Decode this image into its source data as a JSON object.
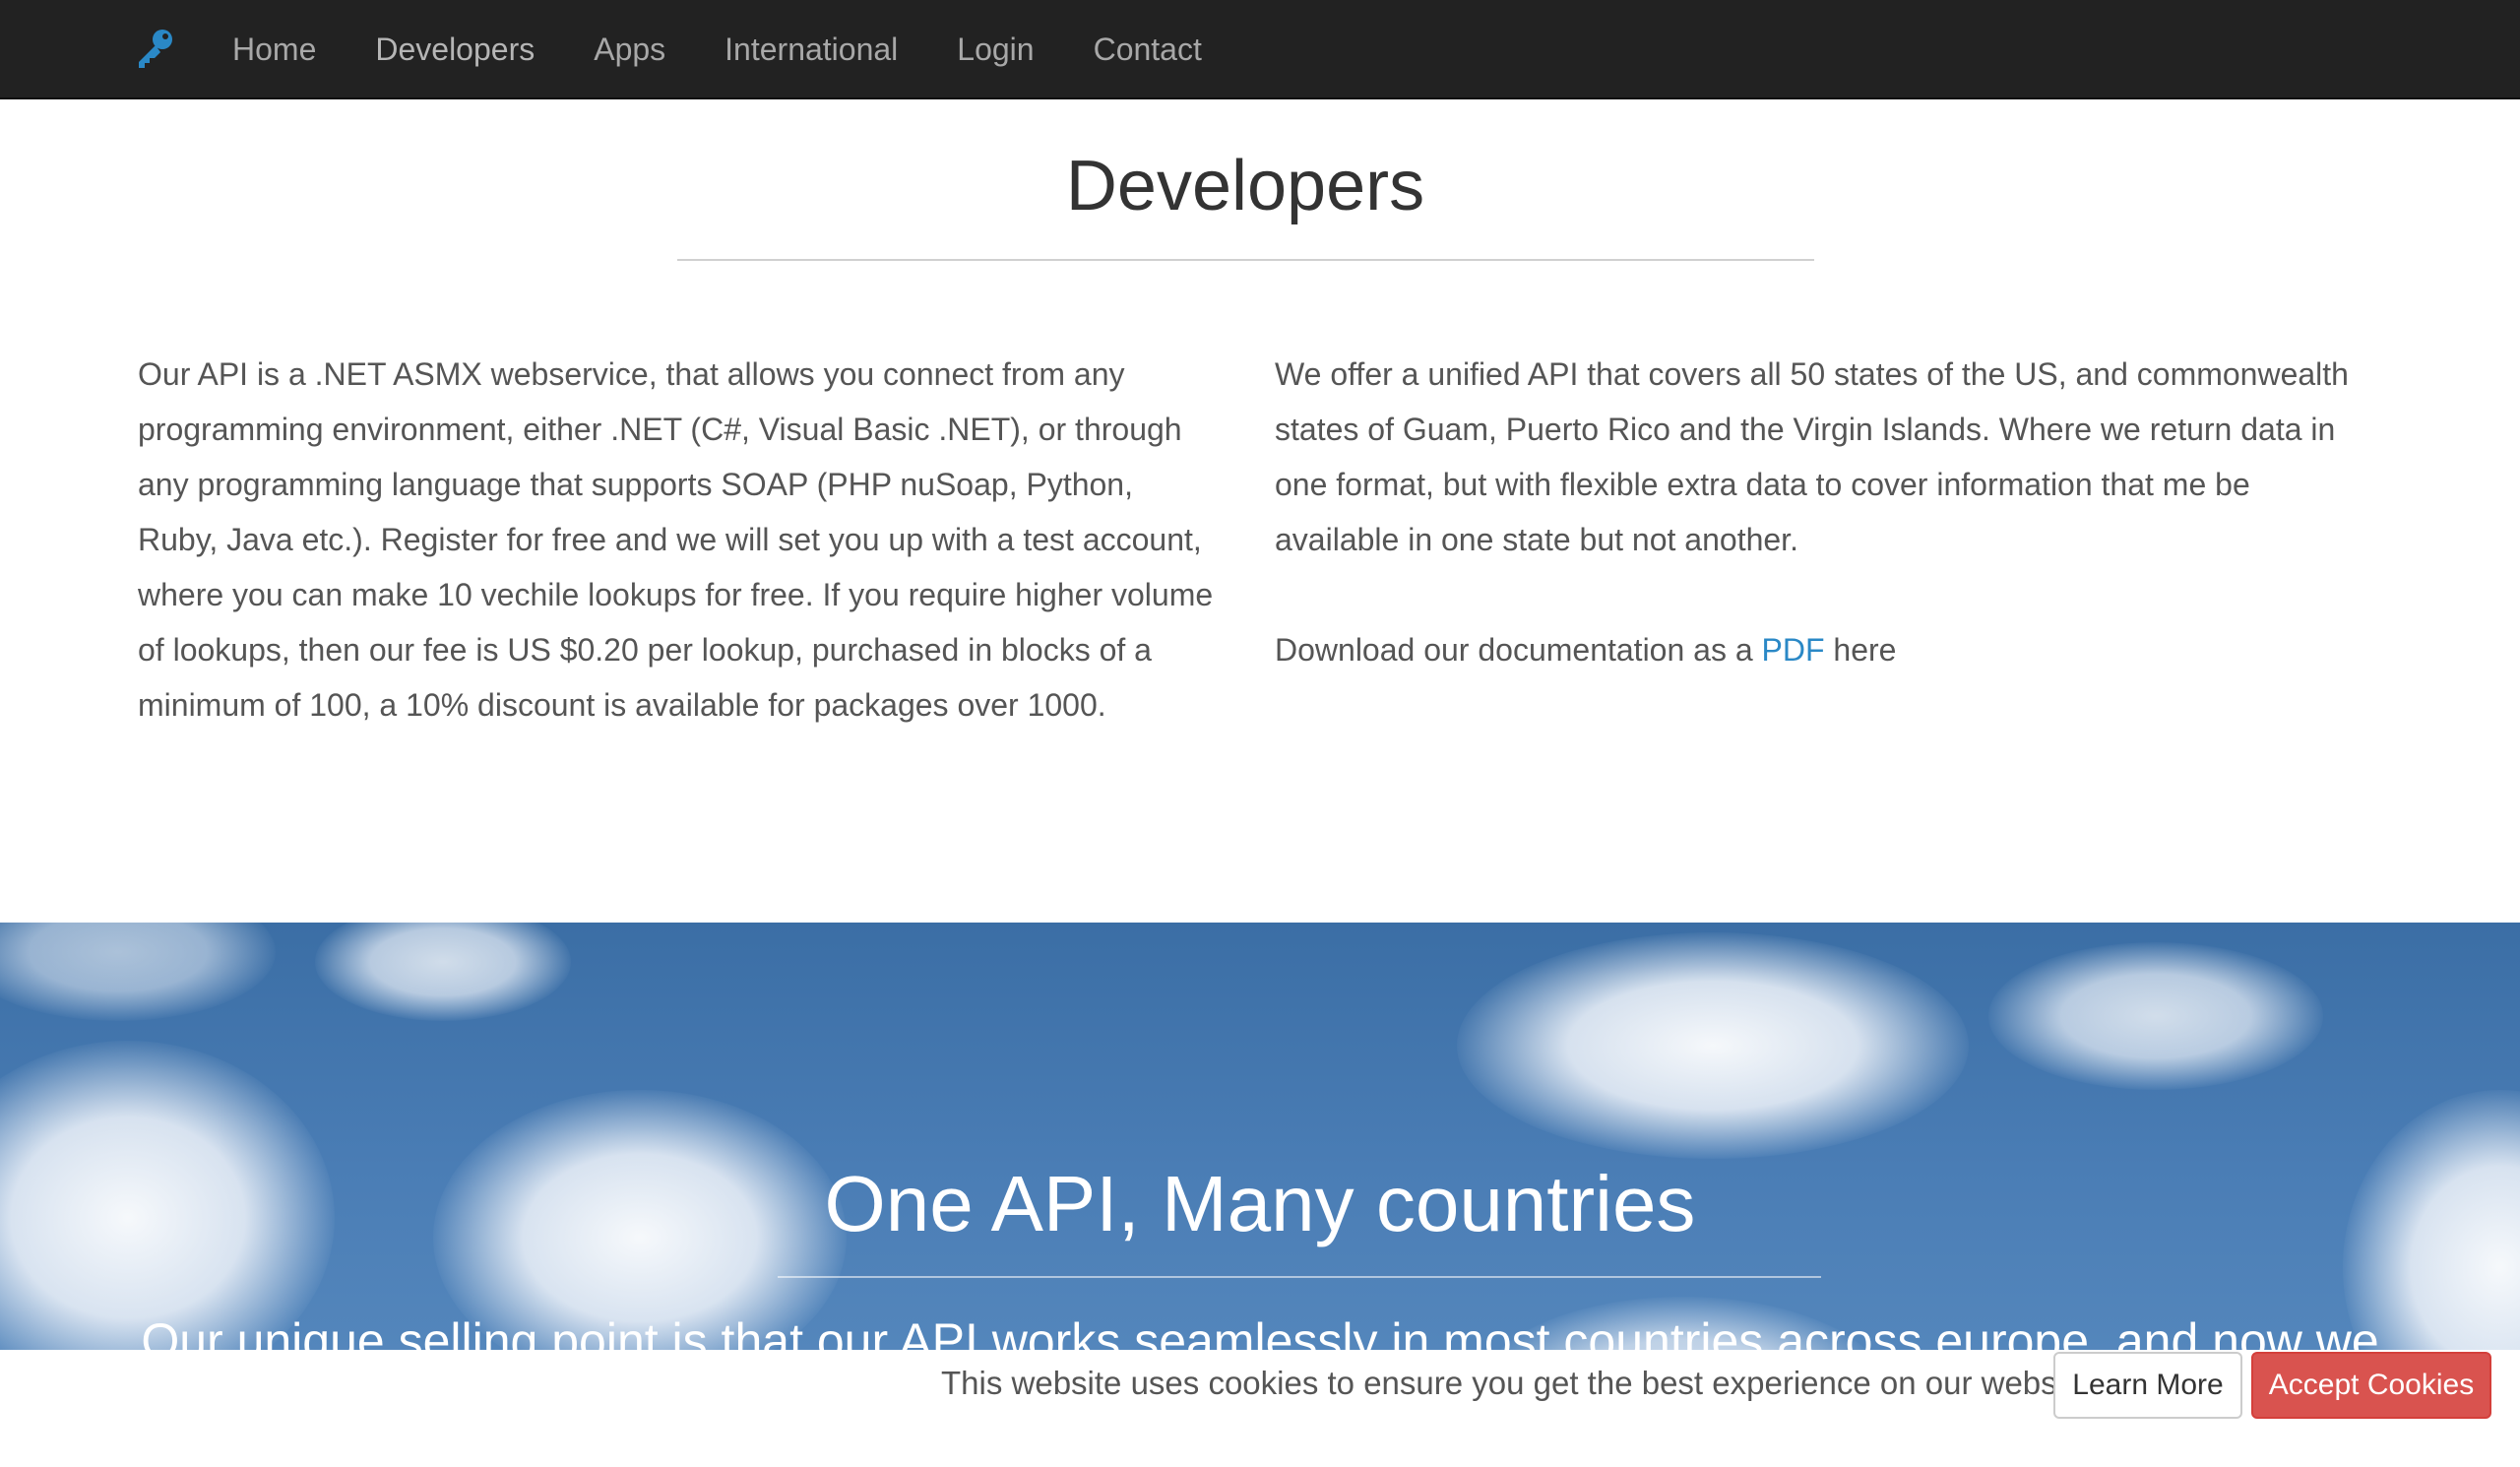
{
  "nav": {
    "brand_icon": "key-icon",
    "items": [
      {
        "label": "Home"
      },
      {
        "label": "Developers"
      },
      {
        "label": "Apps"
      },
      {
        "label": "International"
      },
      {
        "label": "Login"
      },
      {
        "label": "Contact"
      }
    ]
  },
  "developers": {
    "title": "Developers",
    "left_text": "Our API is a .NET ASMX webservice, that allows you connect from any programming environment, either .NET (C#, Visual Basic .NET), or through any programming language that supports SOAP (PHP nuSoap, Python, Ruby, Java etc.). Register for free and we will set you up with a test account, where you can make 10 vechile lookups for free. If you require higher volume of lookups, then our fee is US $0.20 per lookup, purchased in blocks of a minimum of 100, a 10% discount is available for packages over 1000.",
    "right_text": "We offer a unified API that covers all 50 states of the US, and commonwealth states of Guam, Puerto Rico and the Virgin Islands. Where we return data in one format, but with flexible extra data to cover information that me be available in one state but not another.",
    "download_prefix": "Download our documentation as a ",
    "download_link": "PDF",
    "download_suffix": " here"
  },
  "international": {
    "title": "One API, Many countries",
    "subtitle": "Our unique selling point is that our API works seamlessly in most countries across europe, and now we"
  },
  "cookie": {
    "message": "This website uses cookies to ensure you get the best experience on our website.",
    "learn_more": "Learn More",
    "accept": "Accept Cookies"
  },
  "colors": {
    "navbar": "#222222",
    "link": "#2a88c6",
    "accept": "#d9534f"
  }
}
